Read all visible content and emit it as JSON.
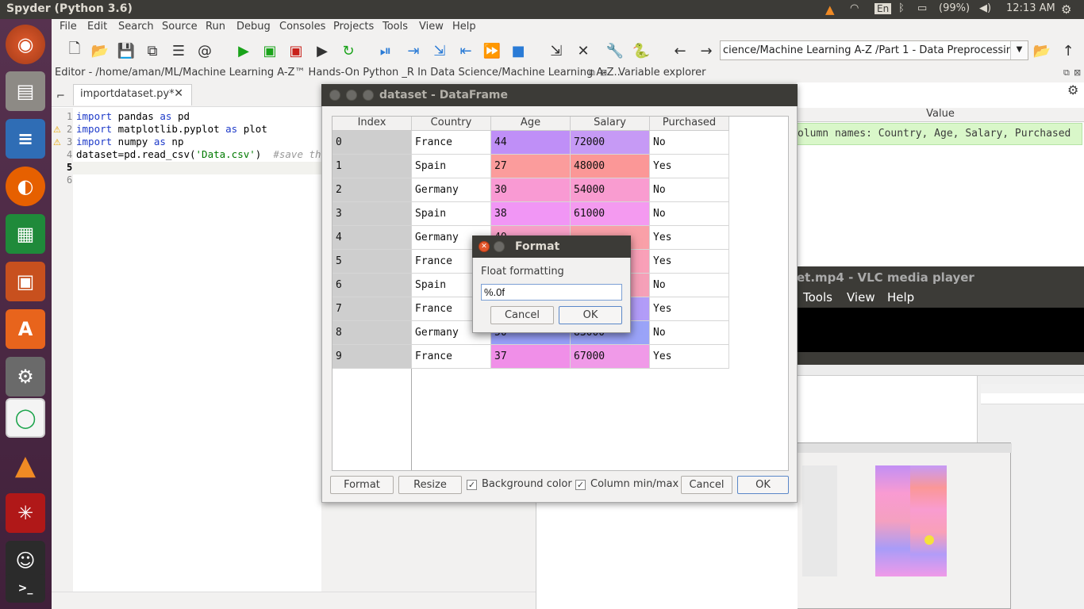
{
  "topbar": {
    "app_title": "Spyder (Python 3.6)",
    "keyboard": "En",
    "battery": "(99%)",
    "clock": "12:13 AM"
  },
  "menu": [
    "File",
    "Edit",
    "Search",
    "Source",
    "Run",
    "Debug",
    "Consoles",
    "Projects",
    "Tools",
    "View",
    "Help"
  ],
  "toolbar": {
    "path": "cience/Machine Learning A-Z /Part 1 - Data Preprocessing"
  },
  "editor": {
    "header": "Editor - /home/aman/ML/Machine Learning A-Z™ Hands-On Python _R In Data Science/Machine Learning A-Z...",
    "tab_label": "importdataset.py*",
    "line_numbers": [
      "1",
      "2",
      "3",
      "4",
      "5",
      "6"
    ],
    "code": {
      "l1a": "import",
      "l1b": " pandas ",
      "l1c": "as",
      "l1d": " pd",
      "l2a": "import",
      "l2b": " matplotlib.pyplot ",
      "l2c": "as",
      "l2d": " plot",
      "l3a": "import",
      "l3b": " numpy ",
      "l3c": "as",
      "l3d": " np",
      "l4a": "dataset=pd.read_csv(",
      "l4b": "'Data.csv'",
      "l4c": ")  ",
      "l4d": "#save th"
    }
  },
  "variable_explorer": {
    "title": "Variable explorer",
    "value_header": "Value",
    "value_text": "olumn names: Country, Age, Salary, Purchased"
  },
  "vlc": {
    "title": "et.mp4 - VLC media player",
    "menu": [
      "Tools",
      "View",
      "Help"
    ]
  },
  "dataframe": {
    "title": "dataset - DataFrame",
    "headers": [
      "Index",
      "Country",
      "Age",
      "Salary",
      "Purchased"
    ],
    "rows": [
      {
        "index": "0",
        "country": "France",
        "age": "44",
        "salary": "72000",
        "purchased": "No"
      },
      {
        "index": "1",
        "country": "Spain",
        "age": "27",
        "salary": "48000",
        "purchased": "Yes"
      },
      {
        "index": "2",
        "country": "Germany",
        "age": "30",
        "salary": "54000",
        "purchased": "No"
      },
      {
        "index": "3",
        "country": "Spain",
        "age": "38",
        "salary": "61000",
        "purchased": "No"
      },
      {
        "index": "4",
        "country": "Germany",
        "age": "40",
        "salary": "",
        "purchased": "Yes"
      },
      {
        "index": "5",
        "country": "France",
        "age": "",
        "salary": "",
        "purchased": "Yes"
      },
      {
        "index": "6",
        "country": "Spain",
        "age": "",
        "salary": "",
        "purchased": "No"
      },
      {
        "index": "7",
        "country": "France",
        "age": "",
        "salary": "",
        "purchased": "Yes"
      },
      {
        "index": "8",
        "country": "Germany",
        "age": "50",
        "salary": "83000",
        "purchased": "No"
      },
      {
        "index": "9",
        "country": "France",
        "age": "37",
        "salary": "67000",
        "purchased": "Yes"
      }
    ],
    "age_colors": [
      "#bf8ff7",
      "#fb9c9c",
      "#f99ad3",
      "#f196f5",
      "#f7a0c8",
      "#f7a0c8",
      "#f7a0c8",
      "#a898f8",
      "#98a0fa",
      "#f08fe8"
    ],
    "salary_colors": [
      "#c69af5",
      "#fb9797",
      "#f99cd0",
      "#f49af0",
      "#f9a0a8",
      "#f9a0b8",
      "#f5a0b8",
      "#b29cf8",
      "#9aa3f8",
      "#f09ae8"
    ],
    "buttons": {
      "format": "Format",
      "resize": "Resize",
      "background_color": "Background color",
      "column_minmax": "Column min/max",
      "cancel": "Cancel",
      "ok": "OK"
    }
  },
  "format_dialog": {
    "title": "Format",
    "label": "Float formatting",
    "value": "%.0f",
    "cancel": "Cancel",
    "ok": "OK"
  }
}
